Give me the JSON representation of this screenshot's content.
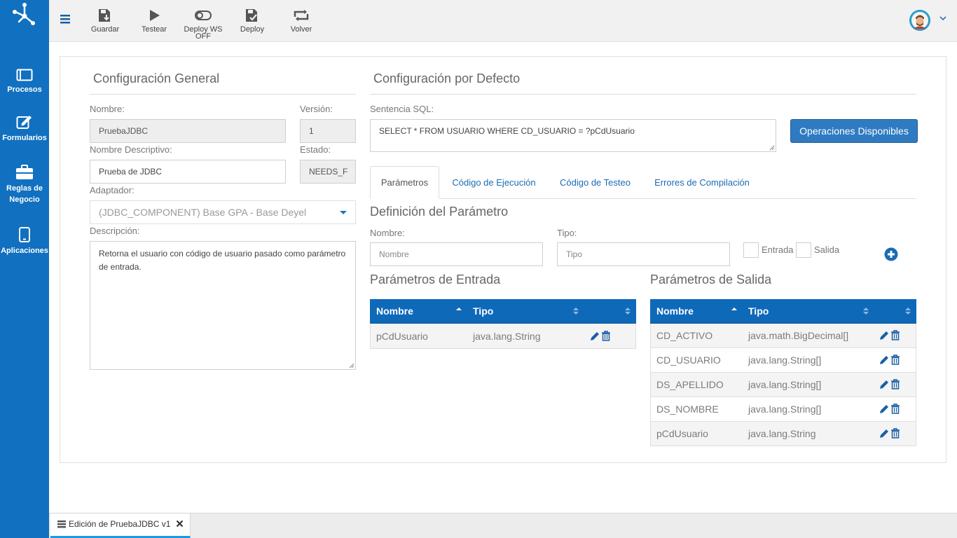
{
  "sidebar": {
    "items": [
      {
        "label": "Procesos"
      },
      {
        "label": "Formularios"
      },
      {
        "label": "Reglas de Negocio"
      },
      {
        "label": "Aplicaciones"
      }
    ]
  },
  "toolbar": {
    "save_label": "Guardar",
    "test_label": "Testear",
    "deploy_ws_label": "Deploy WS OFF",
    "deploy_label": "Deploy",
    "back_label": "Volver"
  },
  "general": {
    "title": "Configuración General",
    "name_label": "Nombre:",
    "name_value": "PruebaJDBC",
    "version_label": "Versión:",
    "version_value": "1",
    "desc_name_label": "Nombre Descriptivo:",
    "desc_name_value": "Prueba de JDBC",
    "state_label": "Estado:",
    "state_value": "NEEDS_F",
    "adapter_label": "Adaptador:",
    "adapter_value": "(JDBC_COMPONENT) Base GPA - Base Deyel",
    "description_label": "Descripción:",
    "description_value": "Retorna el usuario con código de usuario pasado como parámetro de entrada."
  },
  "default_config": {
    "title": "Configuración por Defecto",
    "sql_label": "Sentencia SQL:",
    "sql_value": "SELECT * FROM USUARIO WHERE CD_USUARIO = ?pCdUsuario",
    "operations_button": "Operaciones Disponibles",
    "tabs": [
      {
        "label": "Parámetros"
      },
      {
        "label": "Código de Ejecución"
      },
      {
        "label": "Código de Testeo"
      },
      {
        "label": "Errores de Compilación"
      }
    ],
    "param_def_title": "Definición del Parámetro",
    "param_name_label": "Nombre:",
    "param_name_placeholder": "Nombre",
    "param_type_label": "Tipo:",
    "param_type_placeholder": "Tipo",
    "entrada_label": "Entrada",
    "salida_label": "Salida"
  },
  "input_params": {
    "title": "Parámetros de Entrada",
    "columns": [
      "Nombre",
      "Tipo"
    ],
    "rows": [
      [
        "pCdUsuario",
        "java.lang.String"
      ]
    ]
  },
  "output_params": {
    "title": "Parámetros de Salida",
    "columns": [
      "Nombre",
      "Tipo"
    ],
    "rows": [
      [
        "CD_ACTIVO",
        "java.math.BigDecimal[]"
      ],
      [
        "CD_USUARIO",
        "java.lang.String[]"
      ],
      [
        "DS_APELLIDO",
        "java.lang.String[]"
      ],
      [
        "DS_NOMBRE",
        "java.lang.String[]"
      ],
      [
        "pCdUsuario",
        "java.lang.String"
      ]
    ]
  },
  "bottom_tab": {
    "label": "Edición de PruebaJDBC v1"
  },
  "colors": {
    "sidebar": "#1170c0",
    "table_header": "#0f69b9",
    "primary_button": "#2f7bc2",
    "link": "#1a6cb4"
  },
  "icons": [
    "network-logo-icon",
    "menu-icon",
    "save-icon",
    "play-icon",
    "toggle-icon",
    "deploy-icon",
    "return-icon",
    "procesos-icon",
    "formularios-icon",
    "reglas-icon",
    "aplicaciones-icon",
    "add-circle-icon",
    "edit-icon",
    "trash-icon",
    "sort-icon",
    "close-icon"
  ]
}
